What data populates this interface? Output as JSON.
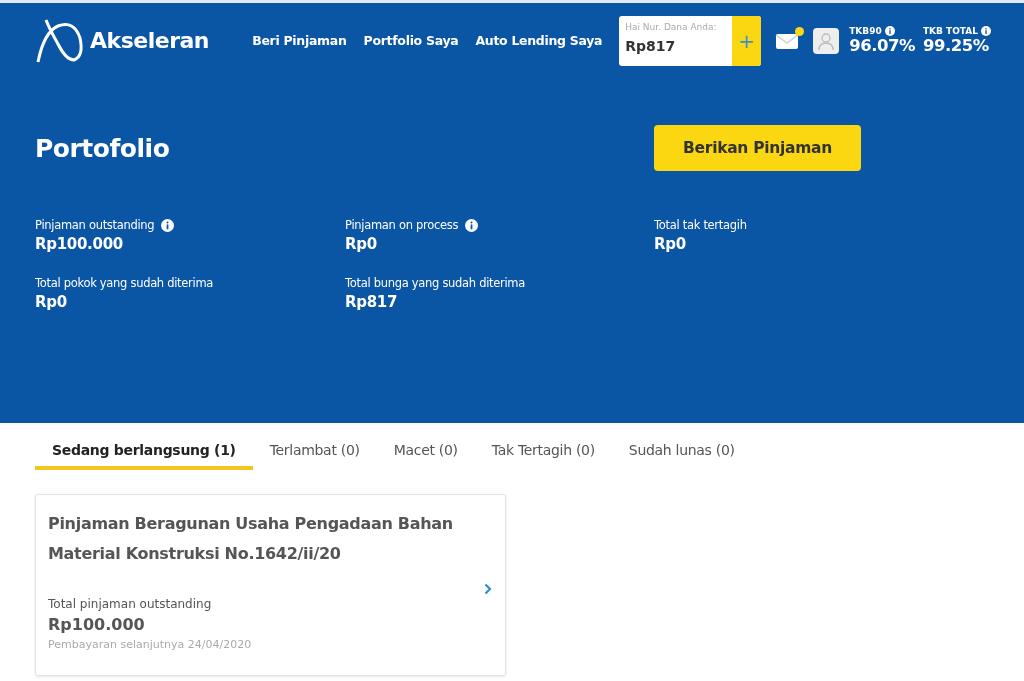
{
  "header": {
    "logo": "Akseleran",
    "nav": [
      {
        "label": "Beri Pinjaman"
      },
      {
        "label": "Portfolio Saya"
      },
      {
        "label": "Auto Lending Saya"
      }
    ],
    "balance": {
      "label": "Hai Nur. Dana Anda:",
      "value": "Rp817",
      "add": "+"
    },
    "mail": {
      "unread": true
    },
    "metrics": [
      {
        "label": "TKB90",
        "value": "96.07%",
        "info": true
      },
      {
        "label": "TKB TOTAL",
        "value": "99.25%",
        "info": true
      }
    ]
  },
  "hero": {
    "title": "Portofolio",
    "cta": "Berikan Pinjaman",
    "stats": [
      {
        "label": "Pinjaman outstanding",
        "value": "Rp100.000",
        "info": true
      },
      {
        "label": "Pinjaman on process",
        "value": "Rp0",
        "info": true
      },
      {
        "label": "Total tak tertagih",
        "value": "Rp0",
        "info": false
      },
      {
        "label": "Total pokok yang sudah diterima",
        "value": "Rp0",
        "info": false
      },
      {
        "label": "Total bunga yang sudah diterima",
        "value": "Rp817",
        "info": false
      }
    ]
  },
  "tabs": [
    {
      "label": "Sedang berlangsung (1)",
      "selected": true
    },
    {
      "label": "Terlambat (0)",
      "selected": false
    },
    {
      "label": "Macet (0)",
      "selected": false
    },
    {
      "label": "Tak Tertagih (0)",
      "selected": false
    },
    {
      "label": "Sudah lunas (0)",
      "selected": false
    }
  ],
  "loans": [
    {
      "title": "Pinjaman Beragunan Usaha Pengadaan Bahan Material Konstruksi No.1642/ii/20",
      "amount_label": "Total pinjaman outstanding",
      "amount": "Rp100.000",
      "next_payment": "Pembayaran selanjutnya 24/04/2020"
    }
  ]
}
